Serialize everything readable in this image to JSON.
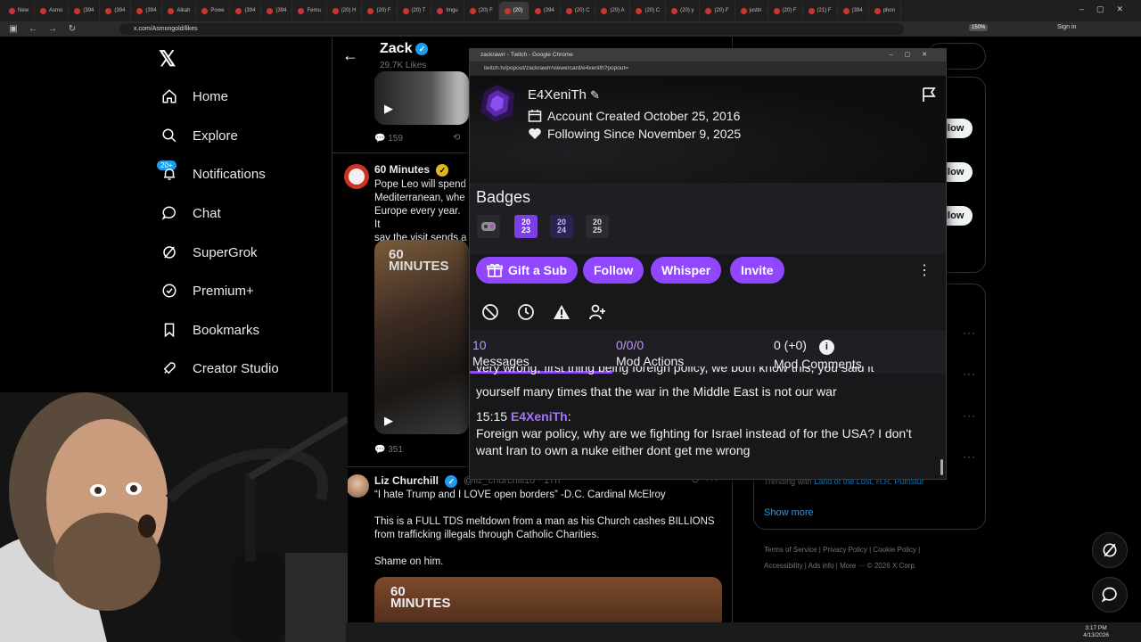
{
  "browser": {
    "tabs": [
      "New",
      "Asmo",
      "(394",
      "(394",
      "(394",
      "Alkah",
      "Powe",
      "(394",
      "(394",
      "Femu",
      "(20) H",
      "(20) F",
      "(20) T",
      "Imgu",
      "(20) F",
      "(20)",
      "(394",
      "(20) C",
      "(20) A",
      "(20) C",
      "(20) y",
      "(20) F",
      "justin",
      "(20) F",
      "(21) F",
      "(394",
      "phon"
    ],
    "active_tab_index": 15,
    "url": "x.com/Asmongold/likes",
    "zoom": "150%",
    "signin": "Sign in"
  },
  "x": {
    "nav": [
      {
        "label": "Home",
        "icon": "home-icon"
      },
      {
        "label": "Explore",
        "icon": "search-icon"
      },
      {
        "label": "Notifications",
        "icon": "bell-icon"
      },
      {
        "label": "Chat",
        "icon": "chat-icon"
      },
      {
        "label": "SuperGrok",
        "icon": "grok-icon"
      },
      {
        "label": "Premium+",
        "icon": "premium-icon"
      },
      {
        "label": "Bookmarks",
        "icon": "bookmark-icon"
      },
      {
        "label": "Creator Studio",
        "icon": "rocket-icon"
      }
    ],
    "notifications_badge": "20+",
    "profile": {
      "name": "Zack",
      "likes": "29.7K Likes"
    },
    "post1_stat_replies": "159",
    "post2": {
      "author": "60 Minutes",
      "handle": "@",
      "text": "Pope Leo will spend\nMediterranean, whe\nEurope every year. It\nsay the visit sends a",
      "thumb_logo": "60\nMINUTES",
      "replies": "351"
    },
    "post3": {
      "author": "Liz Churchill",
      "handle": "@liz_churchill10 · 17h",
      "line1": "“I hate Trump and I LOVE open borders” -D.C. Cardinal McElroy",
      "line2": "This is a FULL TDS meltdown from a man as his Church cashes BILLIONS\nfrom trafficking illegals through Catholic Charities.",
      "line3": "Shame on him.",
      "thumb_logo": "60\nMINUTES"
    },
    "sidebar": {
      "follow_label": "llow",
      "trending_with_prefix": "Trending with",
      "trending_with_links": "Land of the Lost, H.R. Pufnstuf",
      "show_more": "Show more",
      "footer_line1": "Terms of Service  |  Privacy Policy  |  Cookie Policy  |",
      "footer_line2": "Accessibility  |  Ads info  |  More ···  © 2026 X Corp."
    }
  },
  "twitch_popup": {
    "window_title": "zackrawrr - Twitch - Google Chrome",
    "url": "twitch.tv/popout/zackrawrr/viewercard/e4xenith?popout=",
    "username": "E4XeniTh",
    "account_created": "Account Created October 25, 2016",
    "following_since": "Following Since November 9, 2025",
    "badges_title": "Badges",
    "badges": [
      "",
      "20\n23",
      "20\n24",
      "20\n25"
    ],
    "buttons": {
      "gift": "Gift a Sub",
      "follow": "Follow",
      "whisper": "Whisper",
      "invite": "Invite"
    },
    "stats": {
      "messages_value": "10",
      "messages_label": "Messages",
      "mod_actions_value": "0/0/0",
      "mod_actions_label": "Mod Actions",
      "mod_comments_value": "0 (+0)",
      "mod_comments_label": "Mod Comments"
    },
    "chat": {
      "msg1_partial_top": "very wrong, first thing being foreign policy, we both know this, you said it",
      "msg1_partial_bottom": "yourself many times that the war in the Middle East is not our war",
      "msg2_time": "15:15",
      "msg2_user": "E4XeniTh",
      "msg2_text": "Foreign war policy, why are we fighting for Israel instead of for the USA? I don't want Iran to own a nuke either dont get me wrong"
    }
  },
  "taskbar": {
    "time": "3:17 PM",
    "date": "4/13/2026"
  },
  "colors": {
    "twitch_purple": "#9147ff",
    "x_blue": "#1d9bf0",
    "username_purple": "#a970ff"
  }
}
